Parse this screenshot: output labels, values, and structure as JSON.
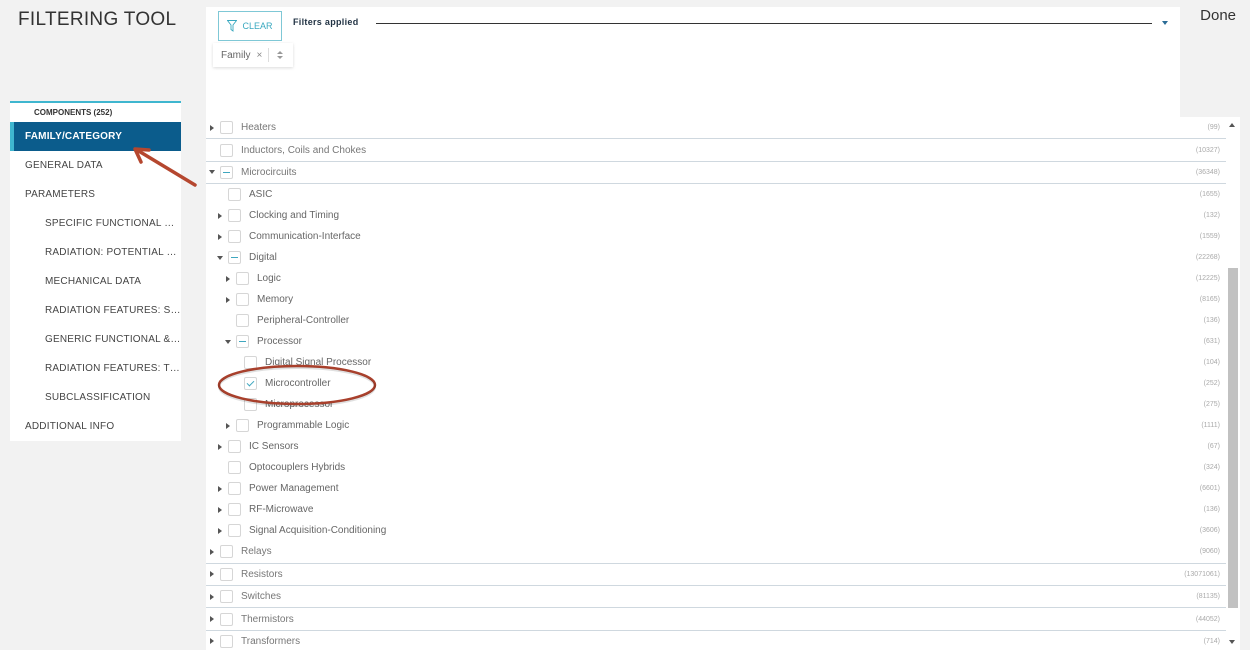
{
  "header": {
    "title": "FILTERING TOOL",
    "done_label": "Done"
  },
  "filters": {
    "clear_label": "CLEAR",
    "applied_label": "Filters applied",
    "chip_label": "Family",
    "chip_remove": "×"
  },
  "sidebar": {
    "tab_label": "COMPONENTS (252)",
    "items": [
      {
        "label": "FAMILY/CATEGORY",
        "active": true
      },
      {
        "label": "GENERAL DATA"
      },
      {
        "label": "PARAMETERS"
      },
      {
        "label": "SPECIFIC FUNCTIONAL & E...",
        "sub": true
      },
      {
        "label": "RADIATION: POTENTIAL SE...",
        "sub": true
      },
      {
        "label": "MECHANICAL DATA",
        "sub": true
      },
      {
        "label": "RADIATION FEATURES: SEE",
        "sub": true
      },
      {
        "label": "GENERIC FUNCTIONAL & E...",
        "sub": true
      },
      {
        "label": "RADIATION FEATURES: TID ...",
        "sub": true
      },
      {
        "label": "SUBCLASSIFICATION",
        "sub": true
      },
      {
        "label": "ADDITIONAL INFO"
      }
    ]
  },
  "tree": {
    "rows": [
      {
        "label": "Heaters",
        "count": "(99)",
        "level": 0,
        "toggle": "collapsed",
        "state": "empty"
      },
      {
        "label": "Inductors, Coils and Chokes",
        "count": "(10327)",
        "level": 0,
        "toggle": "none",
        "state": "empty"
      },
      {
        "label": "Microcircuits",
        "count": "(36348)",
        "level": 0,
        "toggle": "expanded",
        "state": "partial"
      },
      {
        "label": "ASIC",
        "count": "(1655)",
        "level": 1,
        "toggle": "none",
        "state": "empty"
      },
      {
        "label": "Clocking and Timing",
        "count": "(132)",
        "level": 1,
        "toggle": "collapsed",
        "state": "empty"
      },
      {
        "label": "Communication-Interface",
        "count": "(1559)",
        "level": 1,
        "toggle": "collapsed",
        "state": "empty"
      },
      {
        "label": "Digital",
        "count": "(22268)",
        "level": 1,
        "toggle": "expanded",
        "state": "partial"
      },
      {
        "label": "Logic",
        "count": "(12225)",
        "level": 2,
        "toggle": "collapsed",
        "state": "empty"
      },
      {
        "label": "Memory",
        "count": "(8165)",
        "level": 2,
        "toggle": "collapsed",
        "state": "empty"
      },
      {
        "label": "Peripheral-Controller",
        "count": "(136)",
        "level": 2,
        "toggle": "none",
        "state": "empty"
      },
      {
        "label": "Processor",
        "count": "(631)",
        "level": 2,
        "toggle": "expanded",
        "state": "partial"
      },
      {
        "label": "Digital Signal Processor",
        "count": "(104)",
        "level": 3,
        "toggle": "none",
        "state": "empty"
      },
      {
        "label": "Microcontroller",
        "count": "(252)",
        "level": 3,
        "toggle": "none",
        "state": "checked"
      },
      {
        "label": "Microprocessor",
        "count": "(275)",
        "level": 3,
        "toggle": "none",
        "state": "empty"
      },
      {
        "label": "Programmable Logic",
        "count": "(1111)",
        "level": 2,
        "toggle": "collapsed",
        "state": "empty"
      },
      {
        "label": "IC Sensors",
        "count": "(67)",
        "level": 1,
        "toggle": "collapsed",
        "state": "empty"
      },
      {
        "label": "Optocouplers Hybrids",
        "count": "(324)",
        "level": 1,
        "toggle": "none",
        "state": "empty"
      },
      {
        "label": "Power Management",
        "count": "(6601)",
        "level": 1,
        "toggle": "collapsed",
        "state": "empty"
      },
      {
        "label": "RF-Microwave",
        "count": "(136)",
        "level": 1,
        "toggle": "collapsed",
        "state": "empty"
      },
      {
        "label": "Signal Acquisition-Conditioning",
        "count": "(3606)",
        "level": 1,
        "toggle": "collapsed",
        "state": "empty"
      },
      {
        "label": "Relays",
        "count": "(9060)",
        "level": 0,
        "toggle": "collapsed",
        "state": "empty"
      },
      {
        "label": "Resistors",
        "count": "(13071061)",
        "level": 0,
        "toggle": "collapsed",
        "state": "empty"
      },
      {
        "label": "Switches",
        "count": "(81135)",
        "level": 0,
        "toggle": "collapsed",
        "state": "empty"
      },
      {
        "label": "Thermistors",
        "count": "(44052)",
        "level": 0,
        "toggle": "collapsed",
        "state": "empty"
      },
      {
        "label": "Transformers",
        "count": "(714)",
        "level": 0,
        "toggle": "collapsed",
        "state": "empty"
      }
    ]
  },
  "colors": {
    "accent": "#3fb6cf",
    "active_nav": "#0b5c8c",
    "annotation": "#b5472f"
  },
  "icons": {
    "clear": "funnel-icon",
    "annotation_arrow": "arrow-icon",
    "annotation_circle": "ellipse-highlight"
  }
}
